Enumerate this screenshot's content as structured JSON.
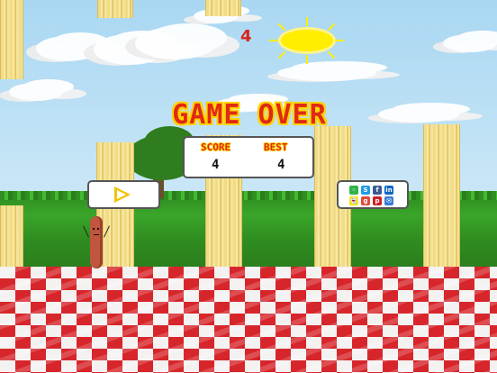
{
  "game": {
    "live_score": "4",
    "title": "GAME OVER",
    "score_label": "SCORE",
    "best_label": "BEST",
    "score_value": "4",
    "best_value": "4"
  },
  "colors": {
    "title_text": "#e02a14",
    "title_outline": "#ffd300",
    "sun": "#ffee00",
    "grass": "#3aa52a",
    "pipe": "#f1dc86",
    "floor_red": "#d7262b",
    "floor_white": "#f4f1f1"
  },
  "controls": {
    "play_icon": "play-icon",
    "share_icons": [
      {
        "name": "messages",
        "symbol": "◦",
        "color": "#2fb34a"
      },
      {
        "name": "skype",
        "symbol": "S",
        "color": "#1d9be6"
      },
      {
        "name": "facebook",
        "symbol": "f",
        "color": "#3b5998"
      },
      {
        "name": "linkedin",
        "symbol": "in",
        "color": "#0a66c2"
      },
      {
        "name": "snapchat",
        "symbol": "👻",
        "color": "#f5e400"
      },
      {
        "name": "google-plus",
        "symbol": "g",
        "color": "#dd4b39"
      },
      {
        "name": "pinterest",
        "symbol": "p",
        "color": "#cb2027"
      },
      {
        "name": "email",
        "symbol": "✉",
        "color": "#3a7bd5"
      }
    ]
  }
}
